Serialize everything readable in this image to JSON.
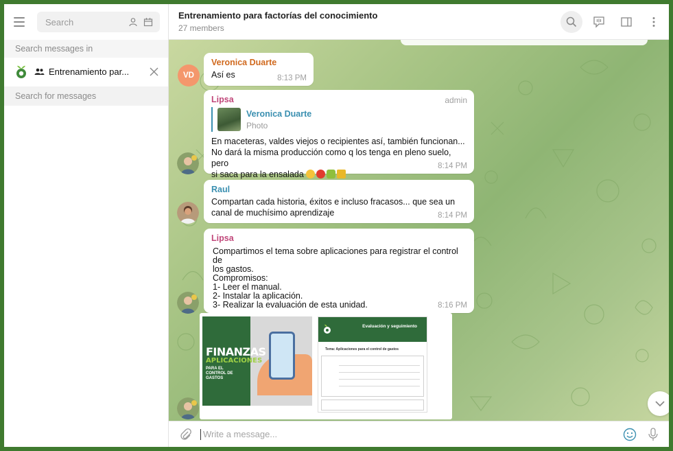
{
  "sidebar": {
    "search_placeholder": "Search",
    "search_messages_in": "Search messages in",
    "chat_chip_name": "Entrenamiento par...",
    "search_for_messages": "Search for messages"
  },
  "header": {
    "title": "Entrenamiento para factorías del conocimiento",
    "subtitle": "27 members"
  },
  "messages": [
    {
      "sender": "Veronica Duarte",
      "text": "Así es",
      "time": "8:13 PM",
      "avatar_initials": "VD"
    },
    {
      "sender": "Lipsa",
      "tag": "admin",
      "reply": {
        "name": "Veronica Duarte",
        "type": "Photo"
      },
      "text": "En maceteras, valdes viejos o recipientes así, también funcionan...\nNo dará la misma producción como q los tenga en pleno suelo, pero\nsi saca para la ensalada",
      "time": "8:14 PM"
    },
    {
      "sender": "Raul",
      "text": "Compartan cada historia, éxitos e incluso fracasos... que sea un\ncanal de muchísimo aprendizaje",
      "time": "8:14 PM"
    },
    {
      "sender": "Lipsa",
      "text": "Compartimos el tema sobre aplicaciones para registrar el control de\nlos gastos.\nCompromisos:\n1- Leer el manual.\n2- Instalar la aplicación.\n3- Realizar la evaluación de esta unidad.",
      "time": "8:16 PM"
    }
  ],
  "album": {
    "card1": {
      "title": "FINANZAS",
      "subtitle": "APLICACIONES",
      "caption": "PARA EL CONTROL DE GASTOS"
    },
    "card2": {
      "header": "Evaluación y seguimiento",
      "tema": "Tema: Aplicaciones para el control de gastos"
    }
  },
  "composer": {
    "placeholder": "Write a message..."
  },
  "colors": {
    "frame": "#3f7a2f",
    "admin_name": "#c0477a",
    "link_name": "#3a8fb0",
    "vd_avatar": "#f4976c"
  },
  "icons": [
    "menu-icon",
    "user-search-icon",
    "calendar-icon",
    "group-icon",
    "close-icon",
    "search-icon",
    "video-chat-icon",
    "sidebar-toggle-icon",
    "more-vertical-icon",
    "chevron-down-icon",
    "attach-icon",
    "emoji-icon",
    "mic-icon"
  ]
}
